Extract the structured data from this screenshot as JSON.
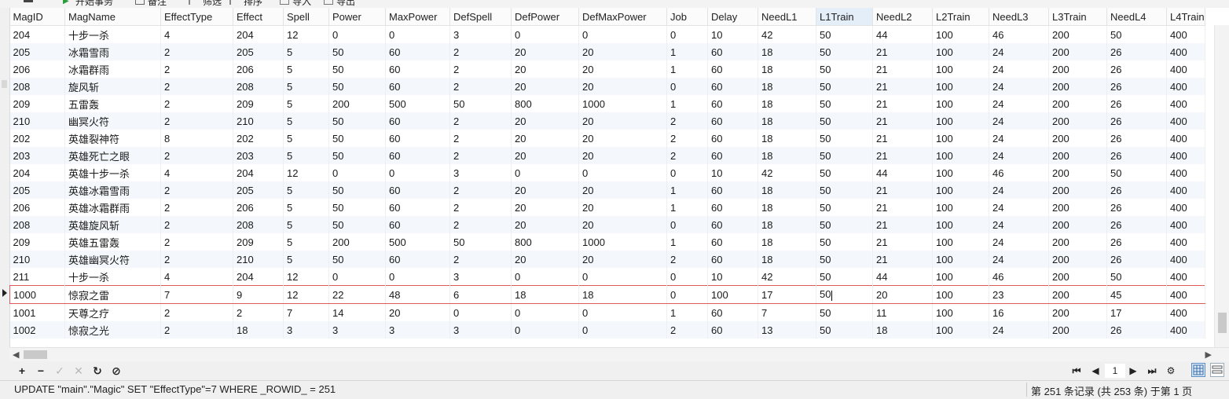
{
  "toolbar": {
    "items": [
      {
        "icon": "menu-icon",
        "label": ""
      },
      {
        "icon": "play-icon",
        "label": "开始事务"
      },
      {
        "icon": "note-icon",
        "label": "备注"
      },
      {
        "icon": "filter-icon",
        "label": "筛选"
      },
      {
        "icon": "sort-icon",
        "label": "排序"
      },
      {
        "icon": "import-icon",
        "label": "导入"
      },
      {
        "icon": "export-icon",
        "label": "导出"
      }
    ]
  },
  "table": {
    "columns": [
      "MagID",
      "MagName",
      "EffectType",
      "Effect",
      "Spell",
      "Power",
      "MaxPower",
      "DefSpell",
      "DefPower",
      "DefMaxPower",
      "Job",
      "Delay",
      "NeedL1",
      "L1Train",
      "NeedL2",
      "L2Train",
      "NeedL3",
      "L3Train",
      "NeedL4",
      "L4Train"
    ],
    "active_column": "L1Train",
    "rows": [
      [
        "204",
        "十步一杀",
        "4",
        "204",
        "12",
        "0",
        "0",
        "3",
        "0",
        "0",
        "0",
        "10",
        "42",
        "50",
        "44",
        "100",
        "46",
        "200",
        "50",
        "400"
      ],
      [
        "205",
        "冰霜雪雨",
        "2",
        "205",
        "5",
        "50",
        "60",
        "2",
        "20",
        "20",
        "1",
        "60",
        "18",
        "50",
        "21",
        "100",
        "24",
        "200",
        "26",
        "400"
      ],
      [
        "206",
        "冰霜群雨",
        "2",
        "206",
        "5",
        "50",
        "60",
        "2",
        "20",
        "20",
        "1",
        "60",
        "18",
        "50",
        "21",
        "100",
        "24",
        "200",
        "26",
        "400"
      ],
      [
        "208",
        "旋风斩",
        "2",
        "208",
        "5",
        "50",
        "60",
        "2",
        "20",
        "20",
        "0",
        "60",
        "18",
        "50",
        "21",
        "100",
        "24",
        "200",
        "26",
        "400"
      ],
      [
        "209",
        "五雷轰",
        "2",
        "209",
        "5",
        "200",
        "500",
        "50",
        "800",
        "1000",
        "1",
        "60",
        "18",
        "50",
        "21",
        "100",
        "24",
        "200",
        "26",
        "400"
      ],
      [
        "210",
        "幽冥火符",
        "2",
        "210",
        "5",
        "50",
        "60",
        "2",
        "20",
        "20",
        "2",
        "60",
        "18",
        "50",
        "21",
        "100",
        "24",
        "200",
        "26",
        "400"
      ],
      [
        "202",
        "英雄裂神符",
        "8",
        "202",
        "5",
        "50",
        "60",
        "2",
        "20",
        "20",
        "2",
        "60",
        "18",
        "50",
        "21",
        "100",
        "24",
        "200",
        "26",
        "400"
      ],
      [
        "203",
        "英雄死亡之眼",
        "2",
        "203",
        "5",
        "50",
        "60",
        "2",
        "20",
        "20",
        "2",
        "60",
        "18",
        "50",
        "21",
        "100",
        "24",
        "200",
        "26",
        "400"
      ],
      [
        "204",
        "英雄十步一杀",
        "4",
        "204",
        "12",
        "0",
        "0",
        "3",
        "0",
        "0",
        "0",
        "10",
        "42",
        "50",
        "44",
        "100",
        "46",
        "200",
        "50",
        "400"
      ],
      [
        "205",
        "英雄冰霜雪雨",
        "2",
        "205",
        "5",
        "50",
        "60",
        "2",
        "20",
        "20",
        "1",
        "60",
        "18",
        "50",
        "21",
        "100",
        "24",
        "200",
        "26",
        "400"
      ],
      [
        "206",
        "英雄冰霜群雨",
        "2",
        "206",
        "5",
        "50",
        "60",
        "2",
        "20",
        "20",
        "1",
        "60",
        "18",
        "50",
        "21",
        "100",
        "24",
        "200",
        "26",
        "400"
      ],
      [
        "208",
        "英雄旋风斩",
        "2",
        "208",
        "5",
        "50",
        "60",
        "2",
        "20",
        "20",
        "0",
        "60",
        "18",
        "50",
        "21",
        "100",
        "24",
        "200",
        "26",
        "400"
      ],
      [
        "209",
        "英雄五雷轰",
        "2",
        "209",
        "5",
        "200",
        "500",
        "50",
        "800",
        "1000",
        "1",
        "60",
        "18",
        "50",
        "21",
        "100",
        "24",
        "200",
        "26",
        "400"
      ],
      [
        "210",
        "英雄幽冥火符",
        "2",
        "210",
        "5",
        "50",
        "60",
        "2",
        "20",
        "20",
        "2",
        "60",
        "18",
        "50",
        "21",
        "100",
        "24",
        "200",
        "26",
        "400"
      ],
      [
        "211",
        "十步一杀",
        "4",
        "204",
        "12",
        "0",
        "0",
        "3",
        "0",
        "0",
        "0",
        "10",
        "42",
        "50",
        "44",
        "100",
        "46",
        "200",
        "50",
        "400"
      ],
      [
        "1000",
        "惊寂之雷",
        "7",
        "9",
        "12",
        "22",
        "48",
        "6",
        "18",
        "18",
        "0",
        "100",
        "17",
        "50",
        "20",
        "100",
        "23",
        "200",
        "45",
        "400"
      ],
      [
        "1001",
        "天尊之疗",
        "2",
        "2",
        "7",
        "14",
        "20",
        "0",
        "0",
        "0",
        "1",
        "60",
        "7",
        "50",
        "11",
        "100",
        "16",
        "200",
        "17",
        "400"
      ],
      [
        "1002",
        "惊寂之光",
        "2",
        "18",
        "3",
        "3",
        "3",
        "3",
        "0",
        "0",
        "2",
        "60",
        "13",
        "50",
        "18",
        "100",
        "24",
        "200",
        "26",
        "400"
      ]
    ],
    "selected_row": 15
  },
  "nav": {
    "left_buttons": [
      {
        "name": "add-record-button",
        "glyph": "+",
        "enabled": true
      },
      {
        "name": "delete-record-button",
        "glyph": "−",
        "enabled": true
      },
      {
        "name": "apply-changes-button",
        "glyph": "✓",
        "enabled": false
      },
      {
        "name": "discard-changes-button",
        "glyph": "✕",
        "enabled": false
      },
      {
        "name": "refresh-button",
        "glyph": "↻",
        "enabled": true
      },
      {
        "name": "stop-button",
        "glyph": "⊘",
        "enabled": true
      }
    ],
    "page_buttons": [
      {
        "name": "first-page-button",
        "glyph": "⏮"
      },
      {
        "name": "prev-page-button",
        "glyph": "◀"
      },
      {
        "name": "next-page-button",
        "glyph": "▶"
      },
      {
        "name": "last-page-button",
        "glyph": "⏭"
      },
      {
        "name": "settings-gear-button",
        "glyph": "⚙"
      }
    ],
    "page_number": "1"
  },
  "status": {
    "sql": "UPDATE \"main\".\"Magic\" SET \"EffectType\"=7 WHERE _ROWID_ = 251",
    "record_info": "第 251 条记录 (共 253 条) 于第 1 页"
  }
}
